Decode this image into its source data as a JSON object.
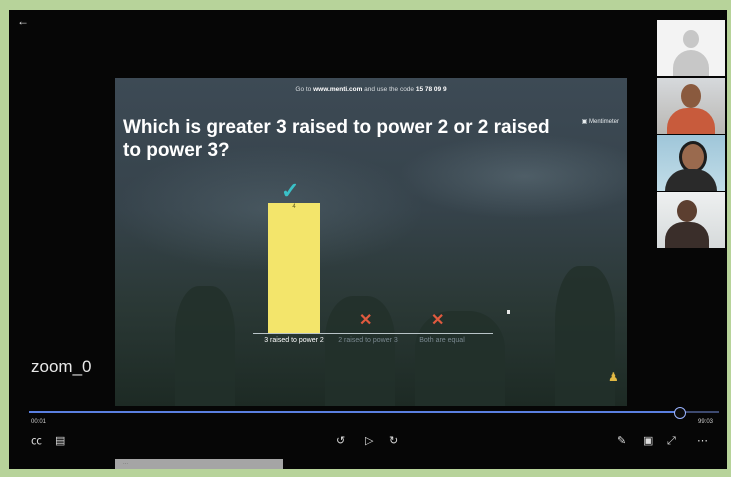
{
  "player": {
    "back_icon": "back-arrow-icon",
    "zoom_label": "zoom_0",
    "time_elapsed": "00:01",
    "time_total": "99:03",
    "progress_fraction": 0.942
  },
  "slide": {
    "header_prefix": "Go to ",
    "header_url": "www.menti.com",
    "header_mid": " and use the code ",
    "header_code": "15 78 09 9",
    "question": "Which is greater 3 raised to power 2 or 2 raised to power 3?",
    "brand": "Mentimeter",
    "options": [
      {
        "label": "3 raised to power 2",
        "correct": true,
        "value": "4"
      },
      {
        "label": "2 raised to power 3",
        "correct": false,
        "value": "0"
      },
      {
        "label": "Both are equal",
        "correct": false,
        "value": "0"
      }
    ],
    "colors": {
      "bar": "#f3e56b",
      "check": "#3ac1c8",
      "cross": "#e05a3f"
    }
  },
  "participants": [
    "participant-1",
    "participant-2",
    "participant-3",
    "participant-4"
  ],
  "controls": {
    "left": [
      "captions-icon",
      "chat-icon"
    ],
    "center": [
      "rewind-icon",
      "play-icon",
      "forward-icon"
    ],
    "right": [
      "pen-icon",
      "pip-icon",
      "fullscreen-icon",
      "more-icon"
    ]
  },
  "bottom_strip_text": "···"
}
